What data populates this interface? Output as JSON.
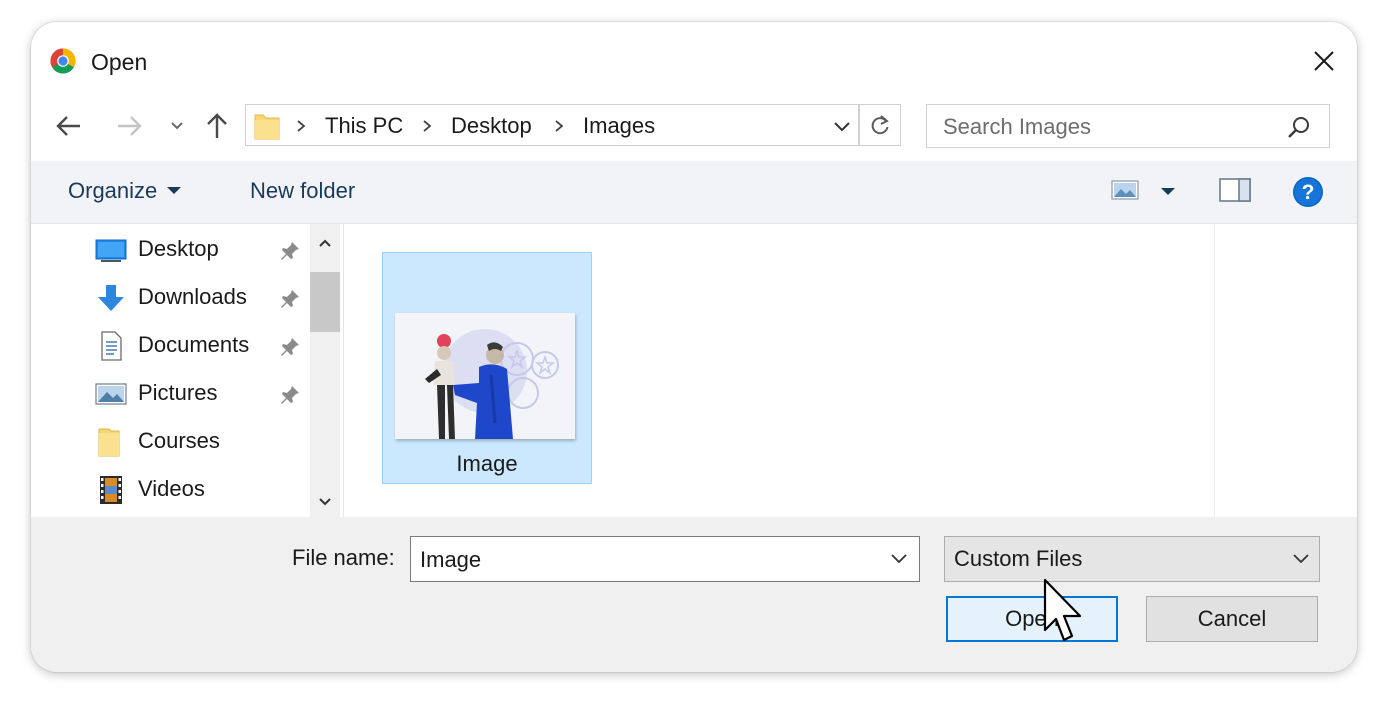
{
  "window": {
    "title": "Open"
  },
  "address": {
    "crumbs": [
      "This PC",
      "Desktop",
      "Images"
    ]
  },
  "search": {
    "placeholder": "Search Images"
  },
  "toolbar": {
    "organize_label": "Organize",
    "new_folder_label": "New folder"
  },
  "sidebar": {
    "items": [
      {
        "label": "Desktop",
        "icon": "desktop-icon",
        "pinned": true
      },
      {
        "label": "Downloads",
        "icon": "download-arrow-icon",
        "pinned": true
      },
      {
        "label": "Documents",
        "icon": "document-icon",
        "pinned": true
      },
      {
        "label": "Pictures",
        "icon": "pictures-icon",
        "pinned": true
      },
      {
        "label": "Courses",
        "icon": "folder-icon",
        "pinned": false
      },
      {
        "label": "Videos",
        "icon": "film-icon",
        "pinned": false
      }
    ]
  },
  "files": [
    {
      "name": "Image",
      "selected": true
    }
  ],
  "footer": {
    "file_name_label": "File name:",
    "file_name_value": "Image",
    "file_type_selected": "Custom Files",
    "open_label": "Open",
    "cancel_label": "Cancel"
  },
  "colors": {
    "accent": "#0078d7",
    "selection": "#cce8ff",
    "help": "#0a64c8",
    "folder": "#f8d775"
  }
}
